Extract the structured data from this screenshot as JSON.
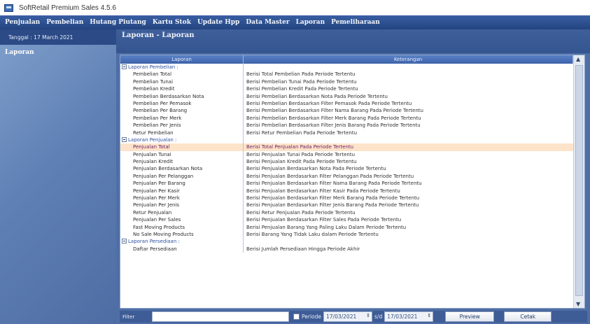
{
  "window": {
    "title": "SoftRetail Premium Sales 4.5.6"
  },
  "menu": [
    "Penjualan",
    "Pembelian",
    "Hutang Piutang",
    "Kartu Stok",
    "Update Hpp",
    "Data Master",
    "Laporan",
    "Pemeliharaan"
  ],
  "sidebar": {
    "date_label": "Tanggal : 17 March 2021",
    "heading": "Laporan"
  },
  "page": {
    "title": "Laporan - Laporan"
  },
  "grid": {
    "headers": [
      "Laporan",
      "Keterangan"
    ],
    "rows": [
      {
        "laporan": "Laporan Pembelian :",
        "keterangan": "",
        "group": true
      },
      {
        "laporan": "Pembelian Total",
        "keterangan": "Berisi Total Pembelian Pada Periode Tertentu"
      },
      {
        "laporan": "Pembelian Tunai",
        "keterangan": "Berisi Pembelian Tunai Pada Periode Tertentu"
      },
      {
        "laporan": "Pembelian Kredit",
        "keterangan": "Berisi Pembelian Kredit Pada Periode Tertentu"
      },
      {
        "laporan": "Pembelian Berdasarkan Nota",
        "keterangan": "Berisi Pembelian Berdasarkan Nota Pada Periode Tertentu"
      },
      {
        "laporan": "Pembelian Per Pemasok",
        "keterangan": "Berisi Pembelian Berdasarkan Filter Pemasok Pada Periode Tertentu"
      },
      {
        "laporan": "Pembelian Per Barang",
        "keterangan": "Berisi Pembelian Berdasarkan Filter Nama Barang Pada Periode Tertentu"
      },
      {
        "laporan": "Pembelian Per Merk",
        "keterangan": "Berisi Pembelian Berdasarkan Filter Merk Barang Pada Periode Tertentu"
      },
      {
        "laporan": "Pembelian Per Jenis",
        "keterangan": "Berisi Pembelian Berdasarkan Filter Jenis Barang Pada Periode Tertentu"
      },
      {
        "laporan": "Retur Pembelian",
        "keterangan": "Berisi Retur Pembelian Pada Periode Tertentu"
      },
      {
        "laporan": "Laporan Penjualan :",
        "keterangan": "",
        "group": true
      },
      {
        "laporan": "Penjualan Total",
        "keterangan": "Berisi Total Penjualan Pada Periode Tertentu",
        "selected": true
      },
      {
        "laporan": "Penjualan Tunai",
        "keterangan": "Berisi Penjualan Tunai Pada Periode Tertentu"
      },
      {
        "laporan": "Penjualan Kredit",
        "keterangan": "Berisi Penjualan Kredit Pada Periode Tertentu"
      },
      {
        "laporan": "Penjualan Berdasarkan Nota",
        "keterangan": "Berisi Penjualan Berdasarkan Nota Pada Periode Tertentu"
      },
      {
        "laporan": "Penjualan Per Pelanggan",
        "keterangan": "Berisi Penjualan Berdasarkan Filter Pelanggan Pada Periode Tertentu"
      },
      {
        "laporan": "Penjualan Per Barang",
        "keterangan": "Berisi Penjualan Berdasarkan Filter Nama Barang Pada Periode Tertentu"
      },
      {
        "laporan": "Penjualan Per Kasir",
        "keterangan": "Berisi Penjualan Berdasarkan Filter Kasir Pada Periode Tertentu"
      },
      {
        "laporan": "Penjualan Per Merk",
        "keterangan": "Berisi Penjualan Berdasarkan Filter Merk Barang Pada Periode Tertentu"
      },
      {
        "laporan": "Penjualan Per Jenis",
        "keterangan": "Berisi Penjualan Berdasarkan Filter Jenis Barang Pada Periode Tertentu"
      },
      {
        "laporan": "Retur Penjualan",
        "keterangan": "Berisi Retur Penjualan Pada Periode Tertentu"
      },
      {
        "laporan": "Penjualan Per Sales",
        "keterangan": "Berisi Penjualan Berdasarkan Filter Sales Pada Periode Tertentu"
      },
      {
        "laporan": "Fast Moving Products",
        "keterangan": "Berisi Penjualan Barang Yang Paling Laku Dalam Periode Tertentu"
      },
      {
        "laporan": "No Sale Moving Products",
        "keterangan": "Berisi Barang Yang Tidak Laku dalam Periode Tertentu"
      },
      {
        "laporan": "Laporan Persediaan :",
        "keterangan": "",
        "group": true
      },
      {
        "laporan": "Daftar Persediaan",
        "keterangan": "Berisi Jumlah Persediaan Hingga Periode Akhir"
      }
    ]
  },
  "filterbar": {
    "filter_label": "Filter",
    "filter_value": "",
    "periode_label": "Periode",
    "date_from": "17/03/2021",
    "sd_label": "s/d",
    "date_to": "17/03/2021",
    "preview_label": "Preview",
    "cetak_label": "Cetak"
  }
}
